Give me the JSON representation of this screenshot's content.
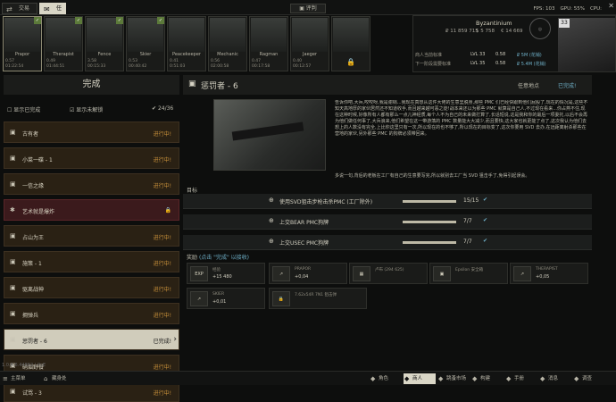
{
  "topbar": {
    "tabs": [
      {
        "label": "交易",
        "icon": "trade-icon"
      },
      {
        "label": "任务",
        "icon": "task-icon"
      }
    ],
    "center_label": "评判",
    "fps": "FPS: 103",
    "gpu": "GPU: 55%",
    "cpu": "CPU: ",
    "close_label": "关闭"
  },
  "traders": [
    {
      "name": "Prapor",
      "lvl": "4",
      "rep": "0.57",
      "time": "01:22:54",
      "badge": "✓",
      "selected": true
    },
    {
      "name": "Therapist",
      "lvl": "3",
      "rep": "0.49",
      "time": "01:44:51",
      "badge": "✓"
    },
    {
      "name": "Fence",
      "lvl": "",
      "rep": "3.58",
      "time": "00:15:33",
      "badge": "✓"
    },
    {
      "name": "Skier",
      "lvl": "",
      "rep": "0.53",
      "time": "00:40:42",
      "badge": "✓"
    },
    {
      "name": "Peacekeeper",
      "lvl": "",
      "rep": "0.41",
      "time": "0:51:03",
      "badge": ""
    },
    {
      "name": "Mechanic",
      "lvl": "",
      "rep": "0.56",
      "time": "02:00:58",
      "badge": ""
    },
    {
      "name": "Ragman",
      "lvl": "",
      "rep": "0.47",
      "time": "00:17:58",
      "badge": ""
    },
    {
      "name": "Jaeger",
      "lvl": "",
      "rep": "0.40",
      "time": "00:12:57",
      "badge": ""
    },
    {
      "name": "",
      "lvl": "",
      "rep": "",
      "time": "",
      "badge": ""
    }
  ],
  "profile": {
    "name": "Byzantinium",
    "level": "33",
    "roubles": "₽ 11 859 715",
    "dollars": "$ 5 758",
    "euros": "€ 14 669",
    "next_level_label": "商人当前标准",
    "next_label": "下一阶段需要标准",
    "req1": "LVL 33",
    "req2": "0.58",
    "req3": "₽ 5M (花销)",
    "req4": "LVL 35",
    "req5": "0.58",
    "req6": "₽ 5.4M (花销)"
  },
  "left": {
    "header": "完成",
    "show_completed": "显示已完成",
    "show_locked": "显示未解锁",
    "count": "24/36",
    "quests": [
      {
        "label": "古有者",
        "status": "进行中!",
        "icon": "pin-icon",
        "type": "normal"
      },
      {
        "label": "小菜一碟 - 1",
        "status": "进行中!",
        "icon": "pin-icon",
        "type": "normal"
      },
      {
        "label": "一信之缘",
        "status": "进行中!",
        "icon": "pin-icon",
        "type": "normal"
      },
      {
        "label": "艺术就是爆炸",
        "status": "",
        "icon": "gear-icon",
        "type": "red",
        "locked": "🔒"
      },
      {
        "label": "占山为王",
        "status": "进行中!",
        "icon": "pin-icon",
        "type": "normal"
      },
      {
        "label": "施策 - 1",
        "status": "进行中!",
        "icon": "pin-icon",
        "type": "normal"
      },
      {
        "label": "驱离战神",
        "status": "进行中!",
        "icon": "pin-icon",
        "type": "normal"
      },
      {
        "label": "拥弹兵",
        "status": "进行中!",
        "icon": "pin-icon",
        "type": "normal"
      },
      {
        "label": "惩罚者 - 6",
        "status": "已完成!",
        "icon": "pin-icon",
        "type": "sel"
      },
      {
        "label": "硝烟野餐",
        "status": "进行中!",
        "icon": "pin-icon",
        "type": "normal"
      },
      {
        "label": "试骂 - 3",
        "status": "进行中!",
        "icon": "pin-icon",
        "type": "normal"
      }
    ]
  },
  "right": {
    "title": "惩罚者 - 6",
    "location_label": "任意地点",
    "status_label": "已完成!",
    "description": "告诉你吧,大兵,咬咬呀,我是谢锅...我现在真想从这件大佬的生意里脱身,那些 PMC 们已经快跟到他们屁股了,现在的情况是,这些不知天高地厚的家伙居然还不知道收手,而且越来越可恶之徒!战本来还以为那些 PMC 就算是自己人,不过现在看来...你占燕不住,现在这种时候,好像所有人都有那么一点儿神经质,每个人不为自己的未来做打算了,长话短说,这是我和你的最后一项委托,以后不会再为他们做任何事了,大兵浪来,他们希望在这一带游荡的 PMC 数量能大大减少,而且要快,这大家也就更能了点了,这次我认为他们去想上的人数没有完全,上比你这里只有一次,所以现在的也不够了,所以现在的目标变了,这次你要用 SVD 去办,在远距离射杀那些在营地的家伙,另外那些 PMC 的狗牌必须带回来。",
    "description2": "多说一句,背后的老板在工厂有自己的生意要写完,所以就别去工厂当 SVD 狙击手了,免得引起误会。",
    "objectives_label": "目标",
    "objectives": [
      {
        "text": "使用SVD狙击步枪击杀PMC (工厂除外)",
        "count": "15/15",
        "progress": 1.0
      },
      {
        "text": "上交BEAR PMC狗牌",
        "count": "7/7",
        "progress": 1.0
      },
      {
        "text": "上交USEC PMC狗牌",
        "count": "7/7",
        "progress": 1.0
      }
    ],
    "rewards_label": "奖励",
    "rewards_hint": "(点击 \"完成\" 以接收)",
    "rewards": [
      {
        "icon": "EXP",
        "t1": "经验",
        "t2": "+15 480"
      },
      {
        "icon": "↗",
        "t1": "PRAPOR",
        "t2": "+0,04"
      },
      {
        "icon": "▦",
        "t1": "卢布 (294 625)",
        "t2": ""
      },
      {
        "icon": "▣",
        "t1": "Epsilon 安全箱",
        "t2": ""
      },
      {
        "icon": "↗",
        "t1": "THERAPIST",
        "t2": "+0,05"
      },
      {
        "icon": "↗",
        "t1": "SKIER",
        "t2": "+0,01"
      },
      {
        "icon": "🔒",
        "t1": "7.62x54R 7N1 狙击弹",
        "t2": ""
      }
    ]
  },
  "bottom": {
    "version": "1.0.A.6.44882 | PvE",
    "left_buttons": [
      {
        "label": "主菜单",
        "icon": "menu-icon"
      },
      {
        "label": "藏身处",
        "icon": "hideout-icon"
      }
    ],
    "right_buttons": [
      {
        "label": "角色",
        "icon": "character-icon"
      },
      {
        "label": "商人",
        "icon": "trader-icon",
        "active": true
      },
      {
        "label": "跳蚤市场",
        "icon": "flea-icon"
      },
      {
        "label": "构建",
        "icon": "build-icon"
      },
      {
        "label": "手册",
        "icon": "handbook-icon"
      },
      {
        "label": "消息",
        "icon": "message-icon"
      },
      {
        "label": "调查",
        "icon": "survey-icon"
      }
    ]
  },
  "colors": {
    "accent": "#d9d6c6",
    "progress": "#c8903a",
    "red": "#3b1a1c",
    "ok": "#6fb0c8"
  }
}
